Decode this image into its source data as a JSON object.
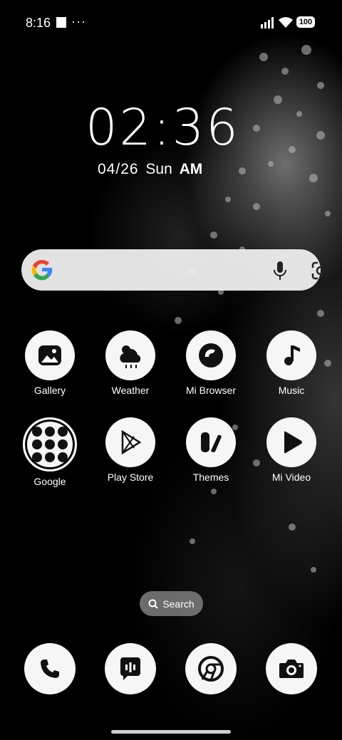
{
  "status_bar": {
    "time": "8:16",
    "battery": "100"
  },
  "lockclock": {
    "time": "02:36",
    "date": "04/26",
    "weekday": "Sun",
    "ampm": "AM"
  },
  "apps_row1": [
    {
      "label": "Gallery"
    },
    {
      "label": "Weather"
    },
    {
      "label": "Mi Browser"
    },
    {
      "label": "Music"
    }
  ],
  "apps_row2": [
    {
      "label": "Google"
    },
    {
      "label": "Play Store"
    },
    {
      "label": "Themes"
    },
    {
      "label": "Mi Video"
    }
  ],
  "search_pill": {
    "label": "Search"
  },
  "dock": [
    {
      "icon": "phone-icon"
    },
    {
      "icon": "messages-icon"
    },
    {
      "icon": "chrome-icon"
    },
    {
      "icon": "camera-icon"
    }
  ]
}
